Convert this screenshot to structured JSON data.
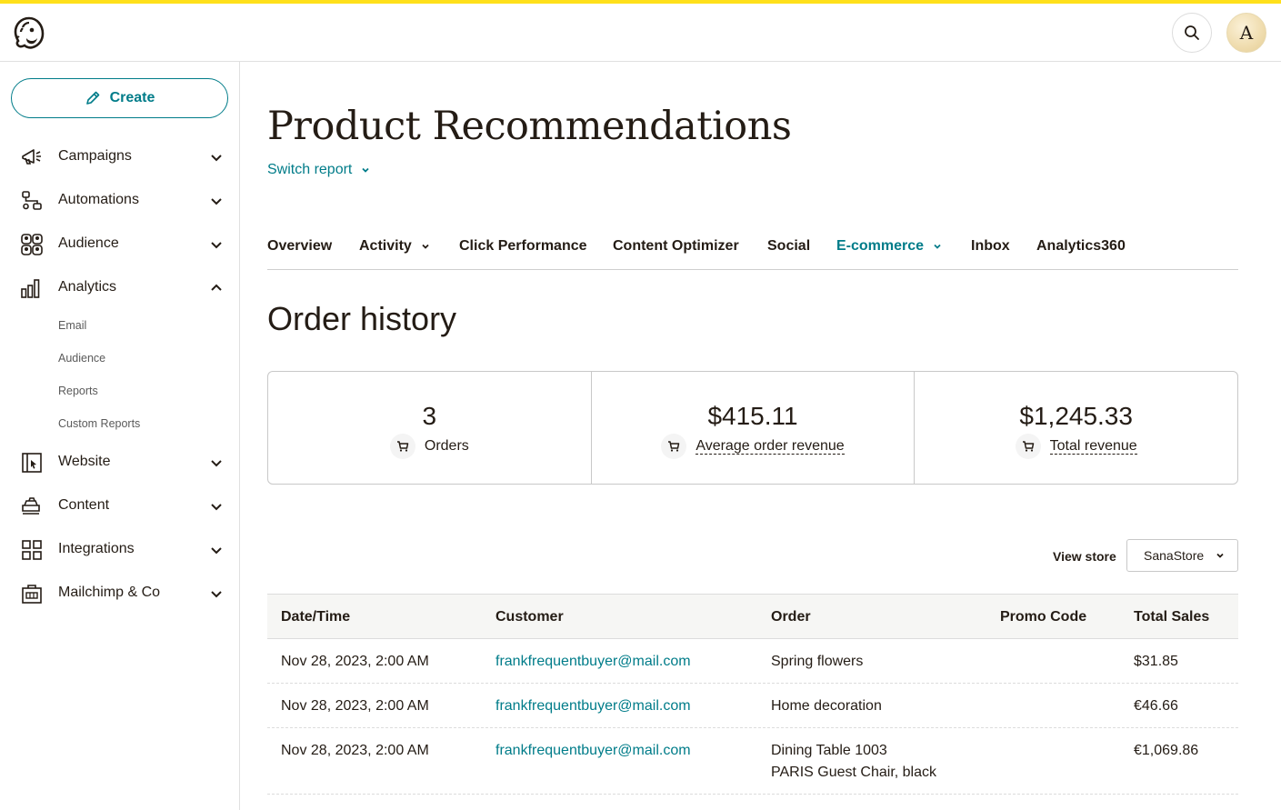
{
  "header": {
    "logo_name": "mailchimp-freddie-logo",
    "avatar_initial": "A",
    "accent_color": "#ffe01b"
  },
  "sidebar": {
    "create_label": "Create",
    "items": [
      {
        "label": "Campaigns",
        "icon": "megaphone-icon",
        "expanded": false
      },
      {
        "label": "Automations",
        "icon": "flow-icon",
        "expanded": false
      },
      {
        "label": "Audience",
        "icon": "people-icon",
        "expanded": false
      },
      {
        "label": "Analytics",
        "icon": "bar-chart-icon",
        "expanded": true
      },
      {
        "label": "Website",
        "icon": "website-icon",
        "expanded": false
      },
      {
        "label": "Content",
        "icon": "content-icon",
        "expanded": false
      },
      {
        "label": "Integrations",
        "icon": "grid-icon",
        "expanded": false
      },
      {
        "label": "Mailchimp & Co",
        "icon": "briefcase-icon",
        "expanded": false
      }
    ],
    "analytics_sub": [
      "Email",
      "Audience",
      "Reports",
      "Custom Reports"
    ]
  },
  "page": {
    "title": "Product Recommendations",
    "switch_report": "Switch report"
  },
  "tabs": [
    {
      "label": "Overview",
      "dropdown": false,
      "active": false
    },
    {
      "label": "Activity",
      "dropdown": true,
      "active": false
    },
    {
      "label": "Click Performance",
      "dropdown": false,
      "active": false
    },
    {
      "label": "Content Optimizer",
      "dropdown": false,
      "active": false
    },
    {
      "label": "Social",
      "dropdown": false,
      "active": false
    },
    {
      "label": "E-commerce",
      "dropdown": true,
      "active": true
    },
    {
      "label": "Inbox",
      "dropdown": false,
      "active": false
    },
    {
      "label": "Analytics360",
      "dropdown": false,
      "active": false
    }
  ],
  "order_history": {
    "title": "Order history",
    "stats": [
      {
        "value": "3",
        "label": "Orders"
      },
      {
        "value": "$415.11",
        "label": "Average order revenue"
      },
      {
        "value": "$1,245.33",
        "label": "Total revenue"
      }
    ],
    "view_store_label": "View store",
    "store_selected": "SanaStore",
    "columns": [
      "Date/Time",
      "Customer",
      "Order",
      "Promo Code",
      "Total Sales"
    ],
    "rows": [
      {
        "date": "Nov 28, 2023, 2:00 AM",
        "customer": "frankfrequentbuyer@mail.com",
        "order": [
          "Spring flowers"
        ],
        "promo": "",
        "total": "$31.85"
      },
      {
        "date": "Nov 28, 2023, 2:00 AM",
        "customer": "frankfrequentbuyer@mail.com",
        "order": [
          "Home decoration"
        ],
        "promo": "",
        "total": "€46.66"
      },
      {
        "date": "Nov 28, 2023, 2:00 AM",
        "customer": "frankfrequentbuyer@mail.com",
        "order": [
          "Dining Table 1003",
          "PARIS Guest Chair, black"
        ],
        "promo": "",
        "total": "€1,069.86"
      }
    ]
  },
  "colors": {
    "brand_teal": "#007c89",
    "text_dark": "#241c15",
    "yellow": "#ffe01b"
  }
}
